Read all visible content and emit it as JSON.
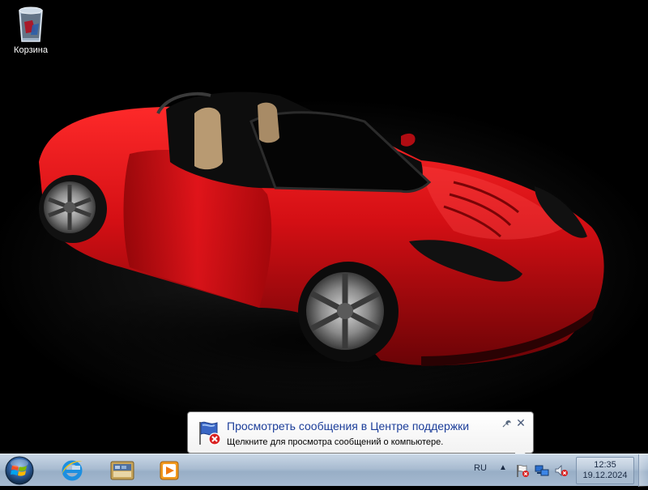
{
  "desktop": {
    "recycle_bin_label": "Корзина"
  },
  "wallpaper": {
    "subject": "red-roadster-car",
    "car_color": "#c8101a"
  },
  "notification": {
    "title": "Просмотреть сообщения в Центре поддержки",
    "text": "Щелкните для просмотра сообщений о компьютере.",
    "title_color": "#1c3e9a"
  },
  "taskbar": {
    "pinned": [
      {
        "icon": "internet-explorer-icon"
      },
      {
        "icon": "windows-explorer-icon"
      },
      {
        "icon": "media-player-icon"
      }
    ],
    "tray": {
      "language": "RU",
      "show_hidden_icon": "▲",
      "icons": [
        "action-center-flag-icon",
        "network-icon",
        "volume-muted-icon"
      ]
    },
    "clock": {
      "time": "12:35",
      "date": "19.12.2024"
    }
  }
}
